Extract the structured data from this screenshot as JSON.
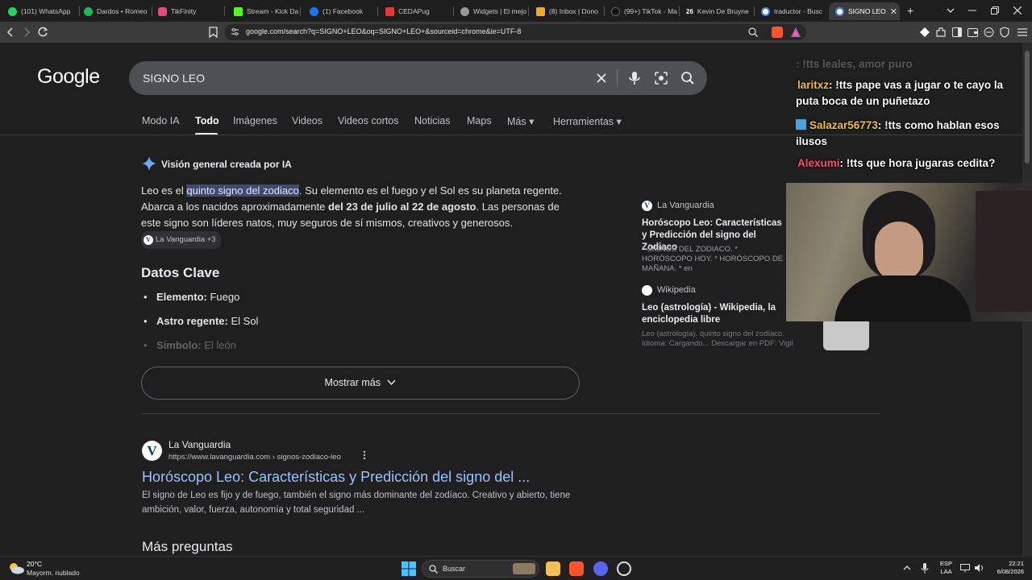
{
  "tabs": [
    {
      "label": "(101) WhatsApp",
      "color": "#25d366"
    },
    {
      "label": "Dardos • Romeo",
      "color": "#1db954"
    },
    {
      "label": "TikFinity",
      "color": "#e84a7f"
    },
    {
      "label": "Stream - Kick Da",
      "color": "#53fc18"
    },
    {
      "label": "(1) Facebook",
      "color": "#1877f2"
    },
    {
      "label": "CEDAPug",
      "color": "#e53935"
    },
    {
      "label": "Widgets | El mejo",
      "color": "#cccccc"
    },
    {
      "label": "(8) Inbox | Dono",
      "color": "#f5a623"
    },
    {
      "label": "(99+) TikTok - Ma",
      "color": "#111111"
    },
    {
      "label": "Kevin De Bruyne",
      "color": "#222222"
    },
    {
      "label": "traductor - Busc",
      "color": "#4285f4"
    },
    {
      "label": "SIGNO LEO",
      "color": "#4285f4"
    }
  ],
  "tab_26_badge": "26",
  "new_tab_symbol": "+",
  "close_symbol": "✕",
  "toolbar": {
    "url": "google.com/search?q=SIGNO+LEO&oq=SIGNO+LEO+&sourceid=chrome&ie=UTF-8"
  },
  "google": {
    "logo": "Google",
    "query": "SIGNO LEO",
    "nav": [
      "Modo IA",
      "Todo",
      "Imágenes",
      "Videos",
      "Videos cortos",
      "Noticias",
      "Maps",
      "Más ▾",
      "Herramientas ▾"
    ],
    "ai_overview_title": "Visión general creada por IA",
    "ai_para": {
      "p1": "Leo es el ",
      "highlight": "quinto signo del zodiaco",
      "p2": ". Su elemento es el fuego y el Sol es su planeta regente. Abarca a los nacidos aproximadamente ",
      "bold": "del 23 de julio al 22 de agosto",
      "p3": ". Las personas de este signo son líderes natos, muy seguros de sí mismos, creativos y generosos. ",
      "chip": "La Vanguardia +3",
      "chip_letter": "V"
    },
    "datos_title": "Datos Clave",
    "datos": [
      {
        "k": "Elemento:",
        "v": "Fuego"
      },
      {
        "k": "Astro regente:",
        "v": "El Sol"
      },
      {
        "k": "Símbolo:",
        "v": "El león"
      }
    ],
    "show_more": "Mostrar más",
    "sources": [
      {
        "site": "La Vanguardia",
        "title": "Horóscopo Leo: Características y Predicción del signo del Zodiaco",
        "desc": "* SIGNOS DEL ZODIACO. * HORÓSCOPO HOY. * HORÓSCOPO DE MAÑANA. * en"
      },
      {
        "site": "Wikipedia",
        "title": "Leo (astrología) - Wikipedia, la enciclopedia libre",
        "desc": "Leo (astrología). quinto signo del zodíaco. Idioma: Cargando... Descargar en PDF: Vigil"
      }
    ],
    "result": {
      "logo_letter": "V",
      "site": "La Vanguardia",
      "url": "https://www.lavanguardia.com › signos-zodiaco-leo",
      "title": "Horóscopo Leo: Características y Predicción del signo del ...",
      "snippet": "El signo de Leo es fijo y de fuego, también el signo más dominante del zodíaco. Creativo y abierto, tiene ambición, valor, fuerza, autonomía y total seguridad ..."
    },
    "mas_preguntas": "Más preguntas"
  },
  "chat": [
    {
      "user": "laritxz",
      "msg": ": !tts pape vas a jugar o te cayo la puta boca de un puñetazo",
      "color": "#f0c03d"
    },
    {
      "user": "Salazar56773",
      "msg": ": !tts como hablan esos ilusos",
      "color": "#f0c03d"
    },
    {
      "user": "Alexumi",
      "msg": ": !tts que hora jugaras cedita?",
      "color": "#ff4b6e"
    }
  ],
  "chat_top_faded": ": !tts leales, amor puro",
  "taskbar": {
    "temp": "20°C",
    "weather": "Mayorm. nublado",
    "search": "Buscar",
    "lang1": "ESP",
    "lang2": "LAA",
    "time": "22:21",
    "date": "6/08/2026"
  }
}
